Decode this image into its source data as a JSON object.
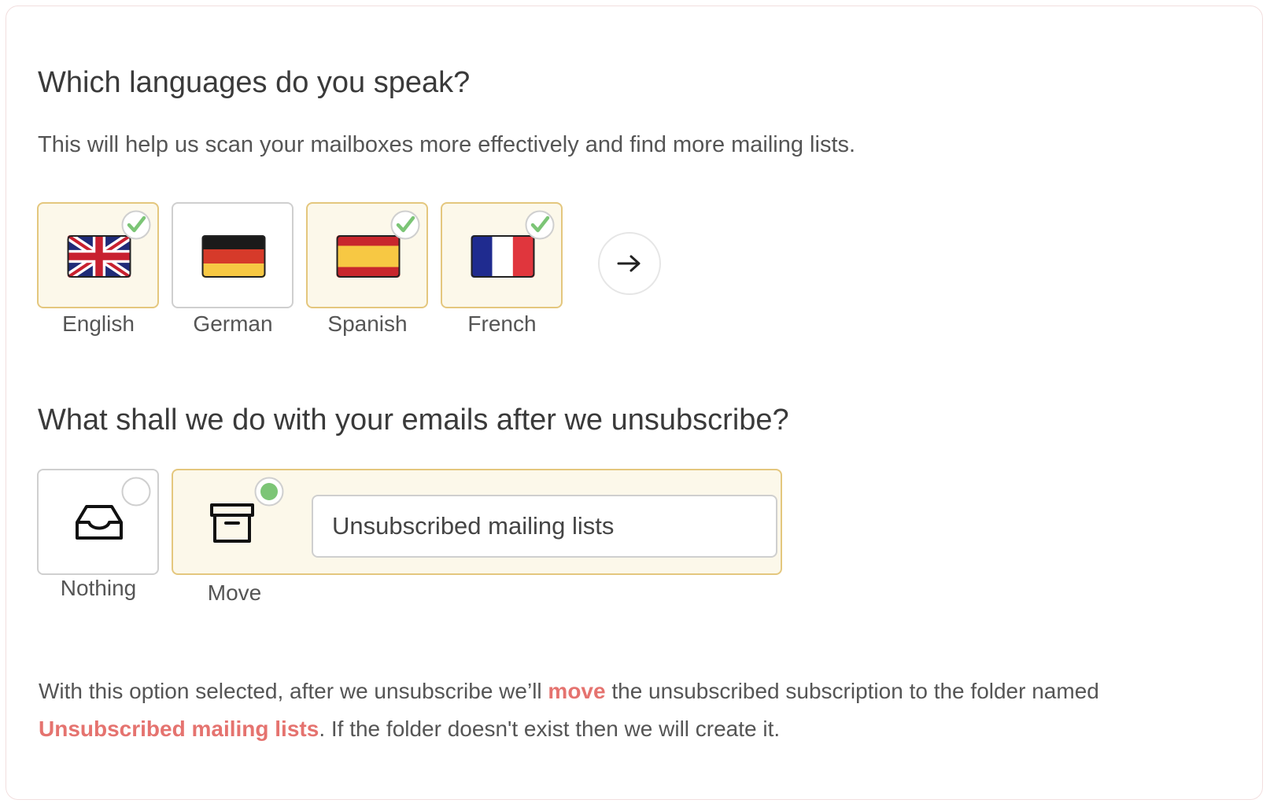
{
  "languages": {
    "heading": "Which languages do you speak?",
    "subtext": "This will help us scan your mailboxes more effectively and find more mailing lists.",
    "options": [
      {
        "label": "English",
        "selected": true,
        "flag": "uk-flag-icon"
      },
      {
        "label": "German",
        "selected": false,
        "flag": "germany-flag-icon"
      },
      {
        "label": "Spanish",
        "selected": true,
        "flag": "spain-flag-icon"
      },
      {
        "label": "French",
        "selected": true,
        "flag": "france-flag-icon"
      }
    ],
    "next_icon": "arrow-right-icon"
  },
  "after_unsubscribe": {
    "heading": "What shall we do with your emails after we unsubscribe?",
    "options": [
      {
        "label": "Nothing",
        "selected": false,
        "icon": "inbox-icon"
      },
      {
        "label": "Move",
        "selected": true,
        "icon": "archive-box-icon"
      }
    ],
    "folder_input_value": "Unsubscribed mailing lists",
    "description": {
      "part1": "With this option selected, after we unsubscribe we’ll ",
      "highlight1": "move",
      "part2": " the unsubscribed subscription to the folder named ",
      "highlight2": "Unsubscribed mailing lists",
      "part3": ". If the folder doesn't exist then we will create it."
    }
  },
  "colors": {
    "selected_border": "#e4c77e",
    "selected_background": "#fcf8ea",
    "check_green": "#7cc576",
    "highlight_red": "#e5736f"
  }
}
